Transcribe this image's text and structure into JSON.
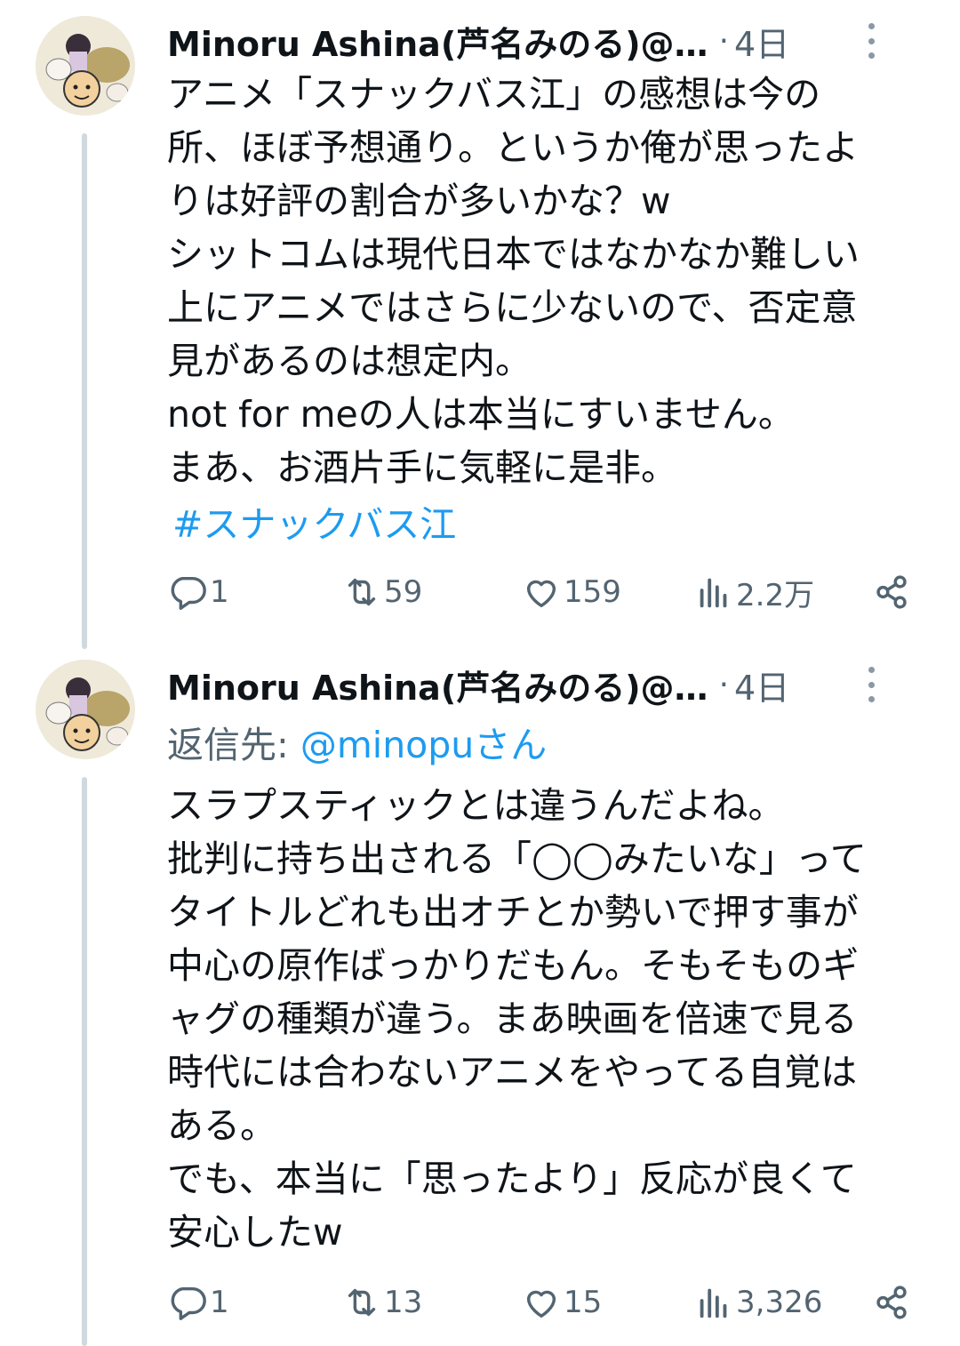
{
  "tweets": [
    {
      "author": "Minoru Ashina(芦名みのる)@…",
      "separator": "·",
      "time": "4日",
      "text": "アニメ「スナックバス江」の感想は今の\n所、ほぼ予想通り。というか俺が思ったよ\nりは好評の割合が多いかな？w\nシットコムは現代日本ではなかなか難しい\n上にアニメではさらに少ないので、否定意\n見があるのは想定内。\nnot for meの人は本当にすいません。\nまあ、お酒片手に気軽に是非。",
      "hashtag": "#スナックバス江",
      "replies": "1",
      "reposts": "59",
      "likes": "159",
      "views": "2.2万"
    },
    {
      "author": "Minoru Ashina(芦名みのる)@…",
      "separator": "·",
      "time": "4日",
      "reply_label": "返信先: ",
      "reply_handle": "@minopuさん",
      "text": "スラプスティックとは違うんだよね。\n批判に持ち出される「◯◯みたいな」って\nタイトルどれも出オチとか勢いで押す事が\n中心の原作ばっかりだもん。そもそものギ\nャグの種類が違う。まあ映画を倍速で見る\n時代には合わないアニメをやってる自覚は\nある。\nでも、本当に「思ったより」反応が良くて\n安心したw",
      "replies": "1",
      "reposts": "13",
      "likes": "15",
      "views": "3,326"
    }
  ],
  "icons": {
    "reply": "reply-icon",
    "repost": "repost-icon",
    "like": "heart-icon",
    "views": "views-icon",
    "share": "share-icon",
    "more": "more-icon"
  },
  "colors": {
    "text": "#0f1419",
    "secondary": "#536471",
    "accent": "#1d9bf0",
    "thread_line": "#cfd9de"
  }
}
